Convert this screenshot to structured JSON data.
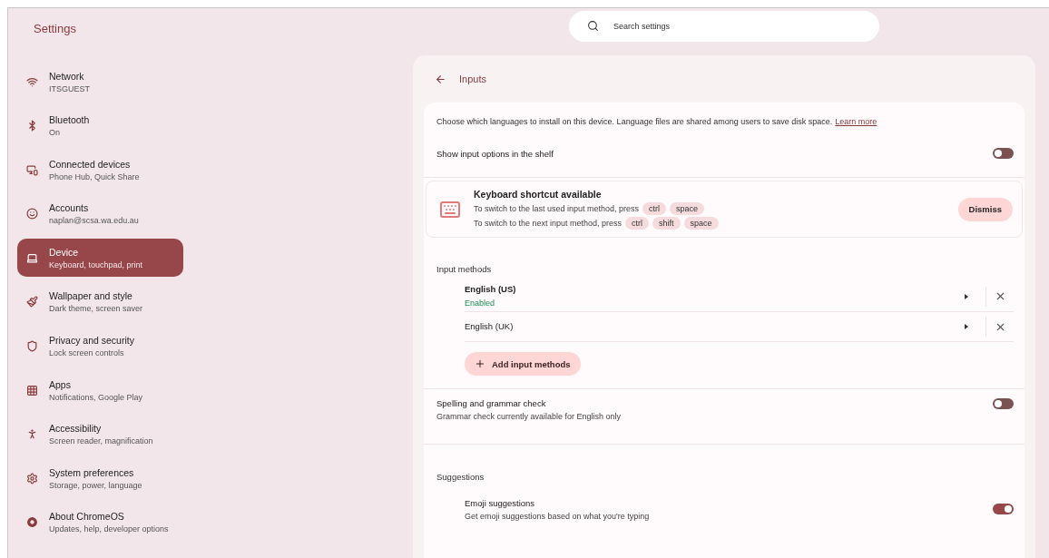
{
  "app": {
    "title": "Settings"
  },
  "search": {
    "placeholder": "Search settings"
  },
  "sidebar": {
    "items": [
      {
        "kind": "wifi",
        "title": "Network",
        "subtitle": "ITSGUEST",
        "selected": false
      },
      {
        "kind": "bluetooth",
        "title": "Bluetooth",
        "subtitle": "On",
        "selected": false
      },
      {
        "kind": "devices",
        "title": "Connected devices",
        "subtitle": "Phone Hub, Quick Share",
        "selected": false
      },
      {
        "kind": "account",
        "title": "Accounts",
        "subtitle": "naplan@scsa.wa.edu.au",
        "selected": false
      },
      {
        "kind": "laptop",
        "title": "Device",
        "subtitle": "Keyboard, touchpad, print",
        "selected": true
      },
      {
        "kind": "paint",
        "title": "Wallpaper and style",
        "subtitle": "Dark theme, screen saver",
        "selected": false
      },
      {
        "kind": "shield",
        "title": "Privacy and security",
        "subtitle": "Lock screen controls",
        "selected": false
      },
      {
        "kind": "apps",
        "title": "Apps",
        "subtitle": "Notifications, Google Play",
        "selected": false
      },
      {
        "kind": "accessibility",
        "title": "Accessibility",
        "subtitle": "Screen reader, magnification",
        "selected": false
      },
      {
        "kind": "gear",
        "title": "System preferences",
        "subtitle": "Storage, power, language",
        "selected": false
      },
      {
        "kind": "chrome",
        "title": "About ChromeOS",
        "subtitle": "Updates, help, developer options",
        "selected": false
      }
    ]
  },
  "page": {
    "title": "Inputs",
    "intro": "Choose which languages to install on this device. Language files are shared among users to save disk space.",
    "intro_link": "Learn more",
    "shelf_toggle": {
      "label": "Show input options in the shelf",
      "on": false
    },
    "shortcut_card": {
      "title": "Keyboard shortcut available",
      "lines": [
        {
          "text": "To switch to the last used input method, press",
          "keys": [
            "ctrl",
            "space"
          ]
        },
        {
          "text": "To switch to the next input method, press",
          "keys": [
            "ctrl",
            "shift",
            "space"
          ]
        }
      ],
      "dismiss": "Dismiss"
    },
    "input_methods": {
      "heading": "Input methods",
      "items": [
        {
          "name": "English (US)",
          "status": "Enabled"
        },
        {
          "name": "English (UK)"
        }
      ],
      "add_button": "Add input methods"
    },
    "spelling_toggle": {
      "label": "Spelling and grammar check",
      "description": "Grammar check currently available for English only",
      "on": false
    },
    "suggestions": {
      "heading": "Suggestions",
      "items": [
        {
          "label": "Emoji suggestions",
          "description": "Get emoji suggestions based on what you're typing",
          "on": true
        }
      ]
    }
  }
}
